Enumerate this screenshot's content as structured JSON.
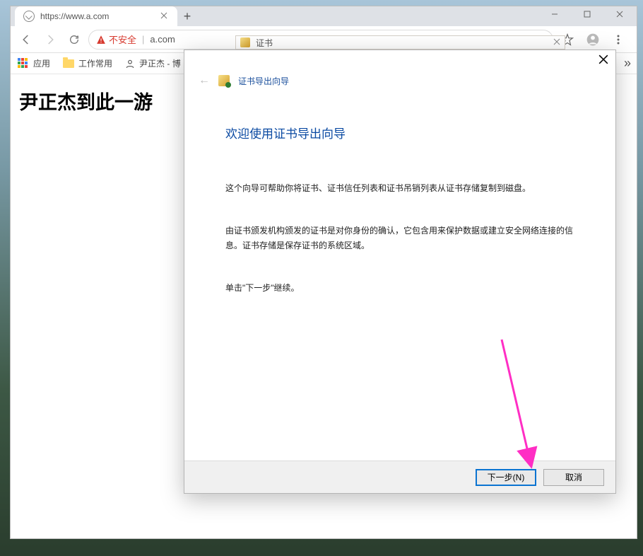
{
  "browser": {
    "tab_title": "https://www.a.com",
    "url_display": "a.com",
    "not_secure_label": "不安全",
    "bookmarks": {
      "apps_label": "应用",
      "work_label": "工作常用",
      "profile_label": "尹正杰 - 博"
    }
  },
  "page": {
    "heading": "尹正杰到此一游"
  },
  "cert_panel": {
    "title": "证书"
  },
  "wizard": {
    "header_title": "证书导出向导",
    "title": "欢迎使用证书导出向导",
    "para1": "这个向导可帮助你将证书、证书信任列表和证书吊销列表从证书存储复制到磁盘。",
    "para2": "由证书颁发机构颁发的证书是对你身份的确认，它包含用来保护数据或建立安全网络连接的信息。证书存储是保存证书的系统区域。",
    "para3": "单击\"下一步\"继续。",
    "next_label": "下一步(N)",
    "cancel_label": "取消"
  }
}
